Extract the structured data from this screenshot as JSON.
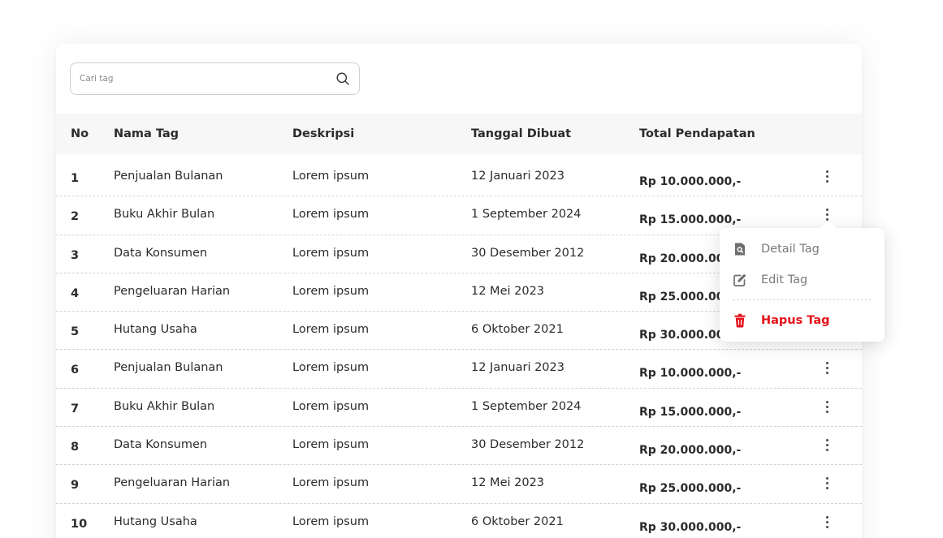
{
  "search": {
    "placeholder": "Cari tag",
    "value": ""
  },
  "table": {
    "headers": {
      "no": "No",
      "name": "Nama Tag",
      "desc": "Deskripsi",
      "date": "Tanggal Dibuat",
      "total": "Total Pendapatan"
    },
    "rows": [
      {
        "no": "1",
        "name": "Penjualan Bulanan",
        "desc": "Lorem ipsum",
        "date": "12 Januari 2023",
        "total": "Rp 10.000.000,-"
      },
      {
        "no": "2",
        "name": "Buku Akhir Bulan",
        "desc": "Lorem ipsum",
        "date": "1 September 2024",
        "total": "Rp 15.000.000,-"
      },
      {
        "no": "3",
        "name": "Data Konsumen",
        "desc": "Lorem ipsum",
        "date": "30 Desember 2012",
        "total": "Rp 20.000.000,-"
      },
      {
        "no": "4",
        "name": "Pengeluaran Harian",
        "desc": "Lorem ipsum",
        "date": "12 Mei 2023",
        "total": "Rp 25.000.000,-"
      },
      {
        "no": "5",
        "name": "Hutang Usaha",
        "desc": "Lorem ipsum",
        "date": "6 Oktober 2021",
        "total": "Rp 30.000.000,-"
      },
      {
        "no": "6",
        "name": "Penjualan Bulanan",
        "desc": "Lorem ipsum",
        "date": "12 Januari 2023",
        "total": "Rp 10.000.000,-"
      },
      {
        "no": "7",
        "name": "Buku Akhir Bulan",
        "desc": "Lorem ipsum",
        "date": "1 September 2024",
        "total": "Rp 15.000.000,-"
      },
      {
        "no": "8",
        "name": "Data Konsumen",
        "desc": "Lorem ipsum",
        "date": "30 Desember 2012",
        "total": "Rp 20.000.000,-"
      },
      {
        "no": "9",
        "name": "Pengeluaran Harian",
        "desc": "Lorem ipsum",
        "date": "12 Mei 2023",
        "total": "Rp 25.000.000,-"
      },
      {
        "no": "10",
        "name": "Hutang Usaha",
        "desc": "Lorem ipsum",
        "date": "6 Oktober 2021",
        "total": "Rp 30.000.000,-"
      }
    ]
  },
  "dropdown": {
    "items": [
      {
        "label": "Detail Tag",
        "icon": "file-search-icon"
      },
      {
        "label": "Edit Tag",
        "icon": "edit-icon"
      },
      {
        "label": "Hapus Tag",
        "icon": "trash-icon"
      }
    ]
  },
  "colors": {
    "danger": "#e3121b",
    "header_bg": "#f7f7f7",
    "muted_text": "#7a7a7a"
  }
}
